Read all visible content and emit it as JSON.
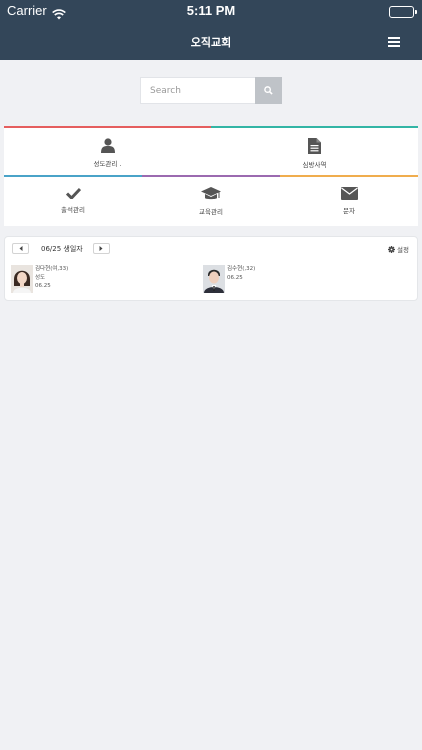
{
  "status_bar": {
    "carrier": "Carrier",
    "time": "5:11 PM"
  },
  "navbar": {
    "title": "오직교회"
  },
  "search": {
    "placeholder": "Search"
  },
  "menu_tiles": [
    {
      "label": "성도관리 ."
    },
    {
      "label": "심방사역"
    },
    {
      "label": "출석관리"
    },
    {
      "label": "교육관리"
    },
    {
      "label": "문자"
    }
  ],
  "birthday": {
    "title": "06/25 생일자",
    "settings_label": "설정",
    "people": [
      {
        "name": "김다현",
        "age": "(여,33)",
        "role": "성도",
        "date": "06.25"
      },
      {
        "name": "김수현",
        "age": "(,32)",
        "role": "",
        "date": "06.25"
      }
    ]
  },
  "colors": {
    "header": "#334659",
    "bar_red": "#e55e5e",
    "bar_teal": "#33b5a5",
    "bar_blue": "#4aa3c8",
    "bar_purple": "#9b6ab0",
    "bar_orange": "#f0ad4e"
  }
}
